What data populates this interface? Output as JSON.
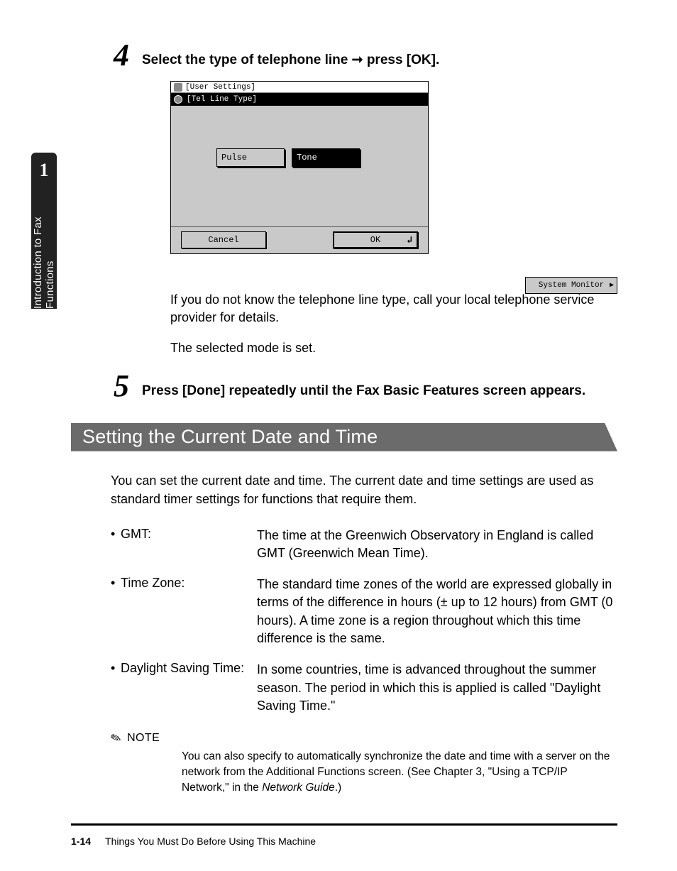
{
  "sidebar": {
    "chapter_number": "1",
    "chapter_title": "Introduction to Fax Functions"
  },
  "step4": {
    "num": "4",
    "text_before": "Select the type of telephone line ",
    "text_after": " press [OK].",
    "arrow": "➞"
  },
  "shot": {
    "ghost_title": "[User Settings]",
    "title": "[Tel Line Type]",
    "pulse": "Pulse",
    "tone": "Tone",
    "cancel": "Cancel",
    "ok": "OK",
    "ok_glyph": "↲",
    "sysmon": "System Monitor",
    "sysmon_glyph": "▶"
  },
  "para1": "If you do not know the telephone line type, call your local telephone service provider for details.",
  "para2": "The selected mode is set.",
  "step5": {
    "num": "5",
    "text": "Press [Done] repeatedly until the Fax Basic Features screen appears."
  },
  "section_title": "Setting the Current Date and Time",
  "intro": "You can set the current date and time. The current date and time settings are used as standard timer settings for functions that require them.",
  "defs": {
    "gmt": {
      "term": "GMT:",
      "desc": "The time at the Greenwich Observatory in England is called GMT (Greenwich Mean Time)."
    },
    "tz": {
      "term": "Time Zone:",
      "desc": "The standard time zones of the world are expressed globally in terms of the difference in hours (± up to 12 hours) from GMT (0 hours). A time zone is a region throughout which this time difference is the same."
    },
    "dst": {
      "term": "Daylight Saving Time:",
      "desc": "In some countries, time is advanced throughout the summer season. The period in which this is applied is called \"Daylight Saving Time.\""
    }
  },
  "note": {
    "icon": "✎",
    "label": "NOTE",
    "body_before": "You can also specify to automatically synchronize the date and time with a server on the network from the Additional Functions screen. (See Chapter 3, \"Using a TCP/IP Network,\" in the ",
    "body_em": "Network Guide",
    "body_after": ".)"
  },
  "footer": {
    "page": "1-14",
    "title": "Things You Must Do Before Using This Machine"
  }
}
